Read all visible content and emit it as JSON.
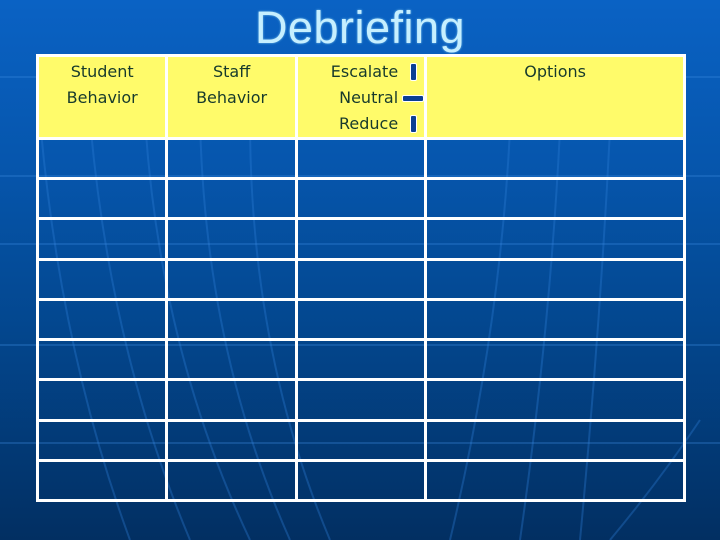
{
  "title": "Debriefing",
  "table": {
    "headers": {
      "student": [
        "Student",
        "Behavior"
      ],
      "staff": [
        "Staff",
        "Behavior"
      ],
      "rating": [
        {
          "label": "Escalate",
          "icon": "up-arrow-icon"
        },
        {
          "label": "Neutral",
          "icon": "left-right-arrow-icon"
        },
        {
          "label": "Reduce",
          "icon": "down-arrow-icon"
        }
      ],
      "options": "Options"
    },
    "rows": [
      [
        "",
        "",
        "",
        ""
      ],
      [
        "",
        "",
        "",
        ""
      ],
      [
        "",
        "",
        "",
        ""
      ],
      [
        "",
        "",
        "",
        ""
      ],
      [
        "",
        "",
        "",
        ""
      ],
      [
        "",
        "",
        "",
        ""
      ],
      [
        "",
        "",
        "",
        ""
      ],
      [
        "",
        "",
        "",
        ""
      ],
      [
        "",
        "",
        "",
        ""
      ]
    ]
  },
  "colors": {
    "header_bg": "#fffb6a",
    "header_text": "#173a2c",
    "title": "#c6efff",
    "grid_lines": "#ffffff",
    "arrow": "#0b3f94"
  }
}
